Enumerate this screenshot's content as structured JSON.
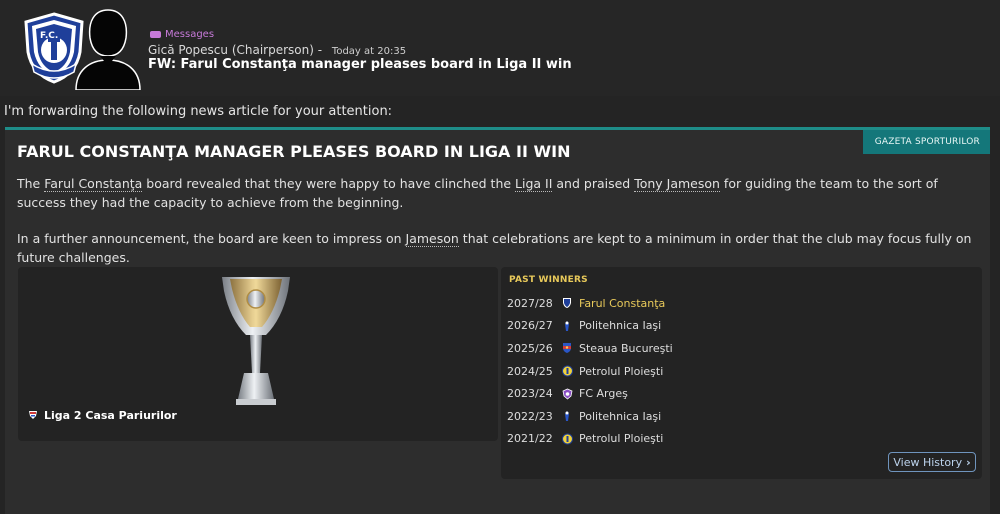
{
  "header": {
    "source": "Messages",
    "sender": "Gică Popescu (Chairperson)",
    "separator": "-",
    "time": "Today at 20:35",
    "subject": "FW: Farul Constanţa manager pleases board in Liga II win"
  },
  "intro": "I'm forwarding the following news article for your attention:",
  "article": {
    "tag": "GAZETA SPORTURILOR",
    "title": "FARUL CONSTANŢA MANAGER PLEASES BOARD IN LIGA II WIN",
    "p1": {
      "t1": "The ",
      "club": "Farul Constanţa",
      "t2": " board revealed that they were happy to have clinched the ",
      "league": "Liga II",
      "t3": " and praised ",
      "manager": "Tony Jameson",
      "t4": " for guiding the team to the sort of success they had the capacity to achieve from the beginning."
    },
    "p2": {
      "t1": "In a further announcement, the board are keen to impress on ",
      "manager": "Jameson",
      "t2": " that celebrations are kept to a minimum in order that the club may focus fully on future challenges."
    }
  },
  "trophy": {
    "league": "Liga 2 Casa Pariurilor"
  },
  "past_winners": {
    "title": "PAST WINNERS",
    "rows": [
      {
        "season": "2027/28",
        "club": "Farul Constanţa",
        "icon": "farul-badge-icon"
      },
      {
        "season": "2026/27",
        "club": "Politehnica Iaşi",
        "icon": "politehnica-badge-icon"
      },
      {
        "season": "2025/26",
        "club": "Steaua Bucureşti",
        "icon": "steaua-badge-icon"
      },
      {
        "season": "2024/25",
        "club": "Petrolul Ploieşti",
        "icon": "petrolul-badge-icon"
      },
      {
        "season": "2023/24",
        "club": "FC Argeş",
        "icon": "arges-badge-icon"
      },
      {
        "season": "2022/23",
        "club": "Politehnica Iaşi",
        "icon": "politehnica-badge-icon"
      },
      {
        "season": "2021/22",
        "club": "Petrolul Ploieşti",
        "icon": "petrolul-badge-icon"
      }
    ],
    "view_history": "View History"
  },
  "colors": {
    "accent_teal": "#14777a",
    "highlight_gold": "#e8c95a",
    "messages_purple": "#c77ad9",
    "crest_blue": "#1f3f9a"
  }
}
